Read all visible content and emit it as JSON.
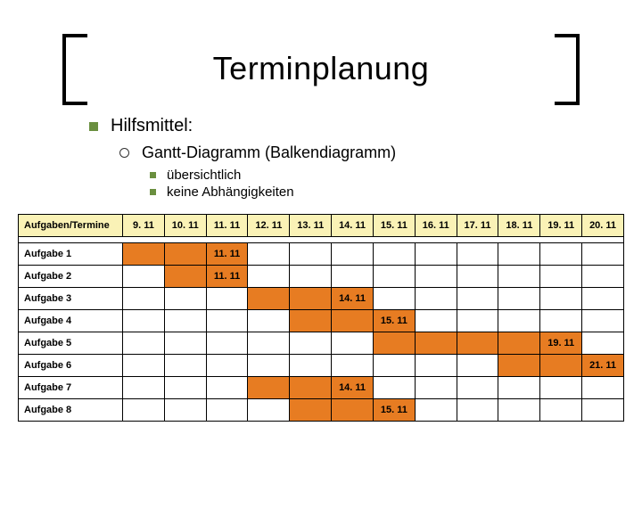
{
  "title": "Terminplanung",
  "bullets": {
    "l1": "Hilfsmittel:",
    "l2": "Gantt-Diagramm (Balkendiagramm)",
    "l3a": "übersichtlich",
    "l3b": "keine Abhängigkeiten"
  },
  "table": {
    "header": "Aufgaben/Termine",
    "dates": [
      "9. 11",
      "10. 11",
      "11. 11",
      "12. 11",
      "13. 11",
      "14. 11",
      "15. 11",
      "16. 11",
      "17. 11",
      "18. 11",
      "19. 11",
      "20. 11"
    ],
    "rows": [
      {
        "name": "Aufgabe 1",
        "start": 0,
        "end": 2,
        "end_label": "11. 11"
      },
      {
        "name": "Aufgabe 2",
        "start": 1,
        "end": 2,
        "end_label": "11. 11"
      },
      {
        "name": "Aufgabe 3",
        "start": 3,
        "end": 5,
        "end_label": "14. 11"
      },
      {
        "name": "Aufgabe 4",
        "start": 4,
        "end": 6,
        "end_label": "15. 11"
      },
      {
        "name": "Aufgabe 5",
        "start": 6,
        "end": 10,
        "end_label": "19. 11"
      },
      {
        "name": "Aufgabe 6",
        "start": 9,
        "end": 12,
        "end_label": "21. 11"
      },
      {
        "name": "Aufgabe 7",
        "start": 3,
        "end": 5,
        "end_label": "14. 11"
      },
      {
        "name": "Aufgabe 8",
        "start": 4,
        "end": 6,
        "end_label": "15. 11"
      }
    ]
  },
  "chart_data": {
    "type": "table",
    "title": "Terminplanung — Gantt-Diagramm",
    "columns": [
      "9.11",
      "10.11",
      "11.11",
      "12.11",
      "13.11",
      "14.11",
      "15.11",
      "16.11",
      "17.11",
      "18.11",
      "19.11",
      "20.11"
    ],
    "series": [
      {
        "name": "Aufgabe 1",
        "start": "9.11",
        "end": "11.11"
      },
      {
        "name": "Aufgabe 2",
        "start": "10.11",
        "end": "11.11"
      },
      {
        "name": "Aufgabe 3",
        "start": "12.11",
        "end": "14.11"
      },
      {
        "name": "Aufgabe 4",
        "start": "13.11",
        "end": "15.11"
      },
      {
        "name": "Aufgabe 5",
        "start": "15.11",
        "end": "19.11"
      },
      {
        "name": "Aufgabe 6",
        "start": "18.11",
        "end": "21.11"
      },
      {
        "name": "Aufgabe 7",
        "start": "12.11",
        "end": "14.11"
      },
      {
        "name": "Aufgabe 8",
        "start": "13.11",
        "end": "15.11"
      }
    ]
  }
}
